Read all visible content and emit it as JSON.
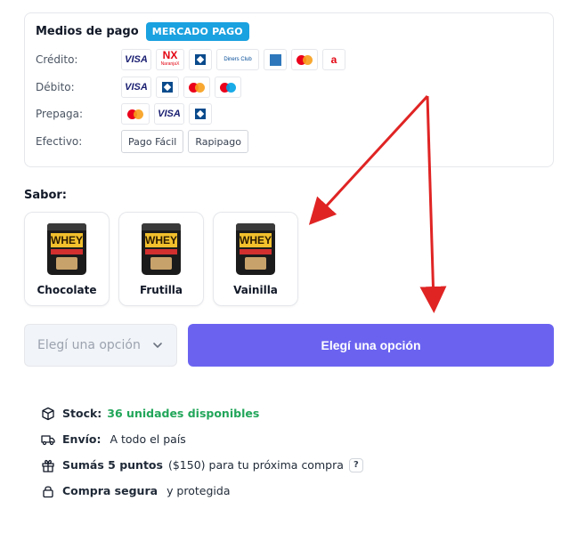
{
  "payment": {
    "title": "Medios de pago",
    "badge": "MERCADO PAGO",
    "rows": [
      {
        "label": "Crédito:",
        "logos": [
          "visa",
          "naranja-x",
          "cabal",
          "diners-club",
          "amex",
          "mastercard",
          "argencard"
        ]
      },
      {
        "label": "Débito:",
        "logos": [
          "visa",
          "cabal",
          "mastercard",
          "maestro"
        ]
      },
      {
        "label": "Prepaga:",
        "logos": [
          "mastercard",
          "visa",
          "cabal"
        ]
      },
      {
        "label": "Efectivo:",
        "logos": [
          "Pago Fácil",
          "Rapipago"
        ]
      }
    ],
    "logo_texts": {
      "visa": "VISA",
      "nx": "NX",
      "nx_sub": "NaranjaX",
      "diners": "Diners Club",
      "argencard": "a",
      "pago_facil": "Pago Fácil",
      "rapipago": "Rapipago"
    }
  },
  "sabor": {
    "label": "Sabor:",
    "options": [
      {
        "name": "Chocolate",
        "brand": "WHEY"
      },
      {
        "name": "Frutilla",
        "brand": "WHEY"
      },
      {
        "name": "Vainilla",
        "brand": "WHEY"
      }
    ]
  },
  "select": {
    "placeholder": "Elegí una opción"
  },
  "buy_button": {
    "label": "Elegí una opción"
  },
  "info": {
    "stock_label": "Stock:",
    "stock_value": "36 unidades disponibles",
    "envio_label": "Envío:",
    "envio_value": "A todo el país",
    "puntos_label": "Sumás 5 puntos",
    "puntos_amount": "($150)",
    "puntos_suffix": "para tu próxima compra",
    "puntos_help": "?",
    "seguro_label": "Compra segura",
    "seguro_value": "y protegida"
  },
  "colors": {
    "accent": "#6b63f0",
    "mercado_pago": "#1aa1e0",
    "stock_green": "#22a65a",
    "annotation_arrow": "#e02424"
  }
}
